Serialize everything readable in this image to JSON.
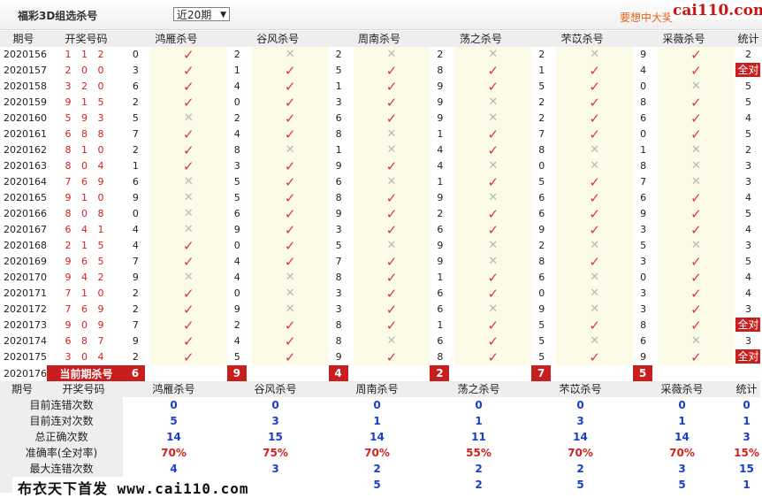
{
  "header": {
    "title": "福彩3D组选杀号",
    "period_select": "近20期",
    "promo": "要想中大奖",
    "brand": "cai110.com"
  },
  "columns": [
    "期号",
    "开奖号码",
    "鸿雁杀号",
    "谷风杀号",
    "周南杀号",
    "荡之杀号",
    "芣苡杀号",
    "采薇杀号",
    "统计"
  ],
  "rows": [
    {
      "id": "2020156",
      "nums": "1 1 2",
      "v": [
        [
          0,
          1
        ],
        [
          2,
          0
        ],
        [
          2,
          0
        ],
        [
          2,
          0
        ],
        [
          2,
          0
        ],
        [
          9,
          1
        ]
      ],
      "tot": "2"
    },
    {
      "id": "2020157",
      "nums": "2 0 0",
      "v": [
        [
          3,
          1
        ],
        [
          1,
          1
        ],
        [
          5,
          1
        ],
        [
          8,
          1
        ],
        [
          1,
          1
        ],
        [
          4,
          1
        ]
      ],
      "tot": "全对"
    },
    {
      "id": "2020158",
      "nums": "3 2 0",
      "v": [
        [
          6,
          1
        ],
        [
          4,
          1
        ],
        [
          1,
          1
        ],
        [
          9,
          1
        ],
        [
          5,
          1
        ],
        [
          0,
          0
        ]
      ],
      "tot": "5"
    },
    {
      "id": "2020159",
      "nums": "9 1 5",
      "v": [
        [
          2,
          1
        ],
        [
          0,
          1
        ],
        [
          3,
          1
        ],
        [
          9,
          0
        ],
        [
          2,
          1
        ],
        [
          8,
          1
        ]
      ],
      "tot": "5"
    },
    {
      "id": "2020160",
      "nums": "5 9 3",
      "v": [
        [
          5,
          0
        ],
        [
          2,
          1
        ],
        [
          6,
          1
        ],
        [
          9,
          0
        ],
        [
          2,
          1
        ],
        [
          6,
          1
        ]
      ],
      "tot": "4"
    },
    {
      "id": "2020161",
      "nums": "6 8 8",
      "v": [
        [
          7,
          1
        ],
        [
          4,
          1
        ],
        [
          8,
          0
        ],
        [
          1,
          1
        ],
        [
          7,
          1
        ],
        [
          0,
          1
        ]
      ],
      "tot": "5"
    },
    {
      "id": "2020162",
      "nums": "8 1 0",
      "v": [
        [
          2,
          1
        ],
        [
          8,
          0
        ],
        [
          1,
          0
        ],
        [
          4,
          1
        ],
        [
          8,
          0
        ],
        [
          1,
          0
        ]
      ],
      "tot": "2"
    },
    {
      "id": "2020163",
      "nums": "8 0 4",
      "v": [
        [
          1,
          1
        ],
        [
          3,
          1
        ],
        [
          9,
          1
        ],
        [
          4,
          0
        ],
        [
          0,
          0
        ],
        [
          8,
          0
        ]
      ],
      "tot": "3"
    },
    {
      "id": "2020164",
      "nums": "7 6 9",
      "v": [
        [
          6,
          0
        ],
        [
          5,
          1
        ],
        [
          6,
          0
        ],
        [
          1,
          1
        ],
        [
          5,
          1
        ],
        [
          7,
          0
        ]
      ],
      "tot": "3"
    },
    {
      "id": "2020165",
      "nums": "9 1 0",
      "v": [
        [
          9,
          0
        ],
        [
          5,
          1
        ],
        [
          8,
          1
        ],
        [
          9,
          0
        ],
        [
          6,
          1
        ],
        [
          6,
          1
        ]
      ],
      "tot": "4"
    },
    {
      "id": "2020166",
      "nums": "8 0 8",
      "v": [
        [
          0,
          0
        ],
        [
          6,
          1
        ],
        [
          9,
          1
        ],
        [
          2,
          1
        ],
        [
          6,
          1
        ],
        [
          9,
          1
        ]
      ],
      "tot": "5"
    },
    {
      "id": "2020167",
      "nums": "6 4 1",
      "v": [
        [
          4,
          0
        ],
        [
          9,
          1
        ],
        [
          3,
          1
        ],
        [
          6,
          1
        ],
        [
          9,
          1
        ],
        [
          3,
          1
        ]
      ],
      "tot": "4"
    },
    {
      "id": "2020168",
      "nums": "2 1 5",
      "v": [
        [
          4,
          1
        ],
        [
          0,
          1
        ],
        [
          5,
          0
        ],
        [
          9,
          0
        ],
        [
          2,
          0
        ],
        [
          5,
          0
        ]
      ],
      "tot": "3"
    },
    {
      "id": "2020169",
      "nums": "9 6 5",
      "v": [
        [
          7,
          1
        ],
        [
          4,
          1
        ],
        [
          7,
          1
        ],
        [
          9,
          0
        ],
        [
          8,
          1
        ],
        [
          3,
          1
        ]
      ],
      "tot": "5"
    },
    {
      "id": "2020170",
      "nums": "9 4 2",
      "v": [
        [
          9,
          0
        ],
        [
          4,
          0
        ],
        [
          8,
          1
        ],
        [
          1,
          1
        ],
        [
          6,
          0
        ],
        [
          0,
          1
        ]
      ],
      "tot": "4"
    },
    {
      "id": "2020171",
      "nums": "7 1 0",
      "v": [
        [
          2,
          1
        ],
        [
          0,
          0
        ],
        [
          3,
          1
        ],
        [
          6,
          1
        ],
        [
          0,
          0
        ],
        [
          3,
          1
        ]
      ],
      "tot": "4"
    },
    {
      "id": "2020172",
      "nums": "7 6 9",
      "v": [
        [
          2,
          1
        ],
        [
          9,
          0
        ],
        [
          3,
          1
        ],
        [
          6,
          0
        ],
        [
          9,
          0
        ],
        [
          3,
          1
        ]
      ],
      "tot": "3"
    },
    {
      "id": "2020173",
      "nums": "9 0 9",
      "v": [
        [
          7,
          1
        ],
        [
          2,
          1
        ],
        [
          8,
          1
        ],
        [
          1,
          1
        ],
        [
          5,
          1
        ],
        [
          8,
          1
        ]
      ],
      "tot": "全对"
    },
    {
      "id": "2020174",
      "nums": "6 8 7",
      "v": [
        [
          9,
          1
        ],
        [
          4,
          1
        ],
        [
          8,
          0
        ],
        [
          6,
          1
        ],
        [
          5,
          0
        ],
        [
          6,
          0
        ]
      ],
      "tot": "3"
    },
    {
      "id": "2020175",
      "nums": "3 0 4",
      "v": [
        [
          2,
          1
        ],
        [
          5,
          1
        ],
        [
          9,
          1
        ],
        [
          8,
          1
        ],
        [
          5,
          1
        ],
        [
          9,
          1
        ]
      ],
      "tot": "全对"
    }
  ],
  "current": {
    "id": "2020176",
    "label": "当前期杀号",
    "values": [
      "6",
      "9",
      "4",
      "2",
      "7",
      "5"
    ]
  },
  "stats_columns": [
    "期号",
    "开奖号码",
    "鸿雁杀号",
    "谷风杀号",
    "周南杀号",
    "荡之杀号",
    "芣苡杀号",
    "采薇杀号",
    "统计"
  ],
  "stats": [
    {
      "label": "目前连错次数",
      "values": [
        "0",
        "0",
        "0",
        "0",
        "0",
        "0",
        "0"
      ],
      "red": false
    },
    {
      "label": "目前连对次数",
      "values": [
        "5",
        "3",
        "1",
        "1",
        "3",
        "1",
        "1"
      ],
      "red": false
    },
    {
      "label": "总正确次数",
      "values": [
        "14",
        "15",
        "14",
        "11",
        "14",
        "14",
        "3"
      ],
      "red": false
    },
    {
      "label": "准确率(全对率)",
      "values": [
        "70%",
        "75%",
        "70%",
        "55%",
        "70%",
        "70%",
        "15%"
      ],
      "red": true
    },
    {
      "label": "最大连错次数",
      "values": [
        "4",
        "3",
        "2",
        "2",
        "2",
        "3",
        "15"
      ],
      "red": false
    },
    {
      "label": "",
      "values": [
        "",
        "",
        "5",
        "2",
        "5",
        "5",
        "1"
      ],
      "red": false
    }
  ],
  "watermark": "布衣天下首发 www.cai110.com",
  "icons": {
    "hit": "check-icon",
    "miss": "cross-icon"
  },
  "colors": {
    "accent_red": "#c81e1e",
    "stat_blue": "#1a3ec8",
    "promo_orange": "#e8631a",
    "cell_tint": "#fbfbe8"
  }
}
